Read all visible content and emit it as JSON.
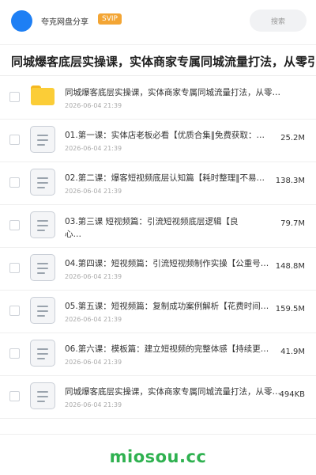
{
  "header": {
    "owner_name": "夸克网盘分享",
    "badge": "SVIP",
    "search_placeholder": "搜索"
  },
  "share_title": "同城爆客底层实操课，实体商家专属同城流量打法，从零引",
  "items": [
    {
      "type": "folder",
      "name": "同城爆客底层实操课，实体商家专属同城流量打法，从零…",
      "date": "2026-06-04 21:39",
      "size": ""
    },
    {
      "type": "file",
      "name": "01.第一课：实体店老板必看【优质合集‖免费获取：…",
      "date": "2026-06-04 21:39",
      "size": "25.2M"
    },
    {
      "type": "file",
      "name": "02.第二课：爆客短视频底层认知篇【耗时整理‖不易…",
      "date": "2026-06-04 21:39",
      "size": "138.3M"
    },
    {
      "type": "file",
      "name": "03.第三课 短视频篇：引流短视频底层逻辑【良心…",
      "date": "2026-06-04 21:39",
      "size": "79.7M"
    },
    {
      "type": "file",
      "name": "04.第四课：短视频篇：引流短视频制作实操【公重号…",
      "date": "2026-06-04 21:39",
      "size": "148.8M"
    },
    {
      "type": "file",
      "name": "05.第五课：短视频篇：复制成功案例解析【花费时间…",
      "date": "2026-06-04 21:39",
      "size": "159.5M"
    },
    {
      "type": "file",
      "name": "06.第六课：模板篇：建立短视频的完整体感【持续更…",
      "date": "2026-06-04 21:39",
      "size": "41.9M"
    },
    {
      "type": "file",
      "name": "同城爆客底层实操课，实体商家专属同城流量打法，从零…",
      "date": "2026-06-04 21:39",
      "size": "494KB"
    }
  ],
  "watermark": "miosou.cc",
  "colors": {
    "avatar": "#1e7ff4",
    "svip_badge": "#f3a534",
    "folder": "#fbcd37",
    "watermark": "#2fb150"
  }
}
